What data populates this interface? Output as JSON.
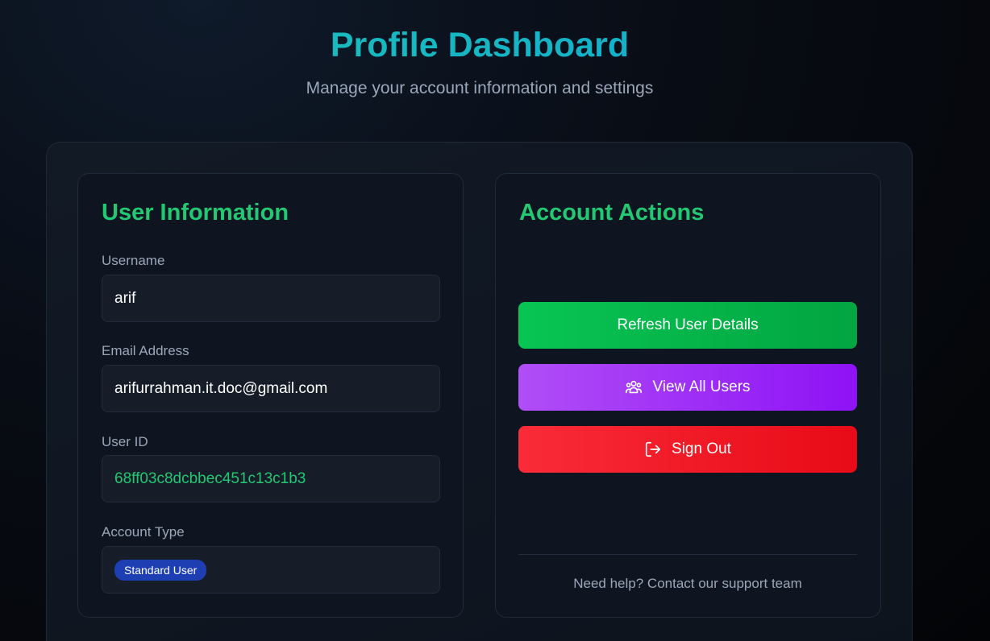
{
  "header": {
    "title": "Profile Dashboard",
    "subtitle": "Manage your account information and settings"
  },
  "user_info": {
    "title": "User Information",
    "fields": [
      {
        "label": "Username",
        "value": "arif"
      },
      {
        "label": "Email Address",
        "value": "arifurrahman.it.doc@gmail.com"
      },
      {
        "label": "User ID",
        "value": "68ff03c8dcbbec451c13c1b3"
      },
      {
        "label": "Account Type",
        "value": "Standard User"
      }
    ]
  },
  "actions": {
    "title": "Account Actions",
    "refresh_label": "Refresh User Details",
    "view_users_label": "View All Users",
    "view_users_icon": "users-icon",
    "sign_out_label": "Sign Out",
    "sign_out_icon": "sign-out-icon",
    "help_text": "Need help? Contact our support team"
  },
  "colors": {
    "accent_green": "#22c872",
    "title_teal": "#13b5c4",
    "button_green": "#08c553",
    "button_purple": "#a032f6",
    "button_red": "#f01c28",
    "badge_blue": "#1d3fb3"
  }
}
